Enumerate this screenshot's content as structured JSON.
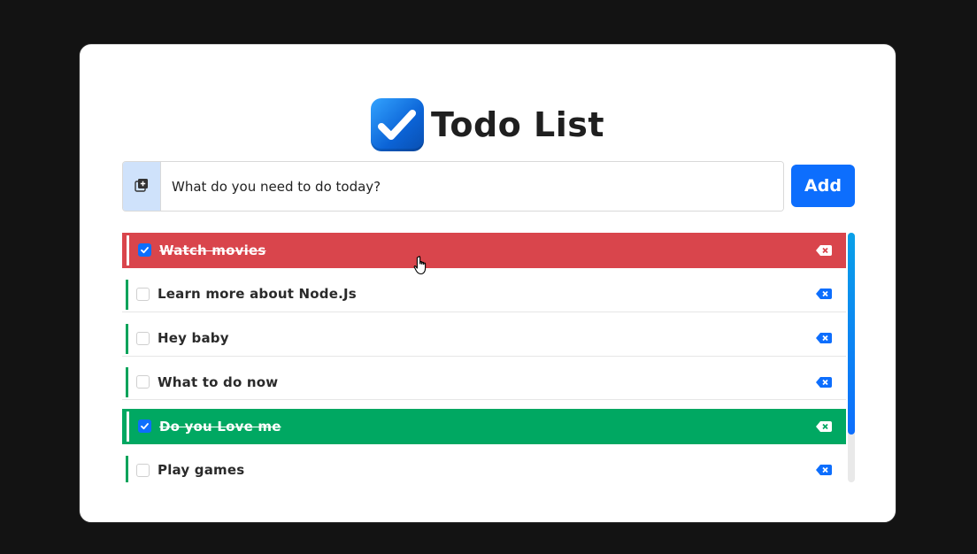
{
  "app": {
    "title": "Todo List",
    "logo_icon": "checkmark-app-logo"
  },
  "input": {
    "placeholder": "What do you need to do today?",
    "value": "",
    "icon": "add-to-queue-icon"
  },
  "add_button": {
    "label": "Add"
  },
  "todos": [
    {
      "text": "Watch movies",
      "checked": true,
      "state": "highlight-red"
    },
    {
      "text": "Learn more about Node.Js",
      "checked": false,
      "state": "normal"
    },
    {
      "text": "Hey baby",
      "checked": false,
      "state": "normal"
    },
    {
      "text": "What to do now",
      "checked": false,
      "state": "normal"
    },
    {
      "text": "Do you Love me",
      "checked": true,
      "state": "highlight-green"
    },
    {
      "text": "Play games",
      "checked": false,
      "state": "normal"
    }
  ],
  "colors": {
    "page_bg": "#131313",
    "card_bg": "#ffffff",
    "primary": "#0d6efd",
    "accent_green": "#00a35a",
    "done_red": "#d9454c",
    "done_green": "#00a862",
    "input_icon_bg": "#cfe2fb"
  }
}
